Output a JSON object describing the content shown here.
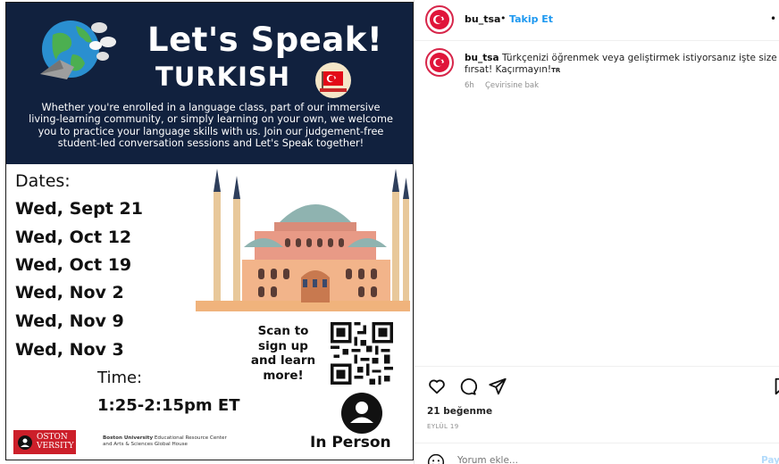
{
  "poster": {
    "title": "Let's Speak!",
    "subtitle": "TURKISH",
    "blurb": "Whether you're enrolled in a language class, part of our immersive living-learning community, or simply learning on your own, we welcome you to practice your language skills with us. Join our judgement-free student-led conversation sessions and Let's Speak together!",
    "dates_label": "Dates:",
    "dates": [
      "Wed, Sept 21",
      "Wed, Oct 12",
      "Wed, Oct 19",
      "Wed, Nov 2",
      "Wed, Nov 9",
      "Wed, Nov 3"
    ],
    "time_label": "Time:",
    "time_value": "1:25-2:15pm ET",
    "scan_text": "Scan to sign up and learn more!",
    "format": "In Person",
    "logo_text": "BOSTON UNIVERSITY",
    "logo_line1": "OSTON",
    "logo_line2": "VERSITY",
    "center_name": "Boston University",
    "center_line1": "Educational Resource Center",
    "center_line2": "and Arts & Sciences Global House"
  },
  "post": {
    "username": "bu_tsa",
    "separator": "•",
    "follow_label": "Takip Et",
    "more_label": "•",
    "caption": "Türkçenizi öğrenmek veya geliştirmek istiyorsanız işte size fırsat! Kaçırmayın!",
    "caption_flag": "TR",
    "time_ago": "6h",
    "translate_label": "Çevirisine bak",
    "likes": "21 beğenme",
    "date": "EYLÜL 19",
    "comment_placeholder": "Yorum ekle...",
    "post_label": "Paylaş"
  },
  "colors": {
    "poster_navy": "#11213e",
    "accent_blue": "#1d98f0",
    "brand_red": "#cc1f2a"
  },
  "icons": [
    "globe-icon",
    "turkish-flag-icon",
    "qr-code",
    "person-icon",
    "heart-icon",
    "comment-icon",
    "share-icon",
    "bookmark-icon",
    "emoji-icon",
    "more-icon"
  ]
}
